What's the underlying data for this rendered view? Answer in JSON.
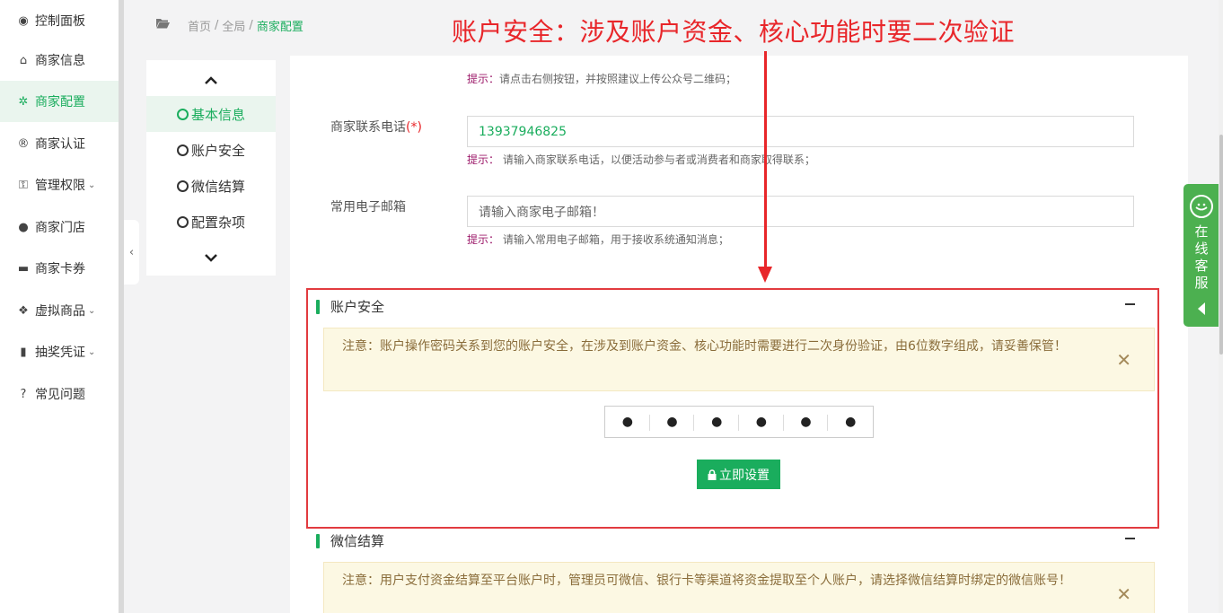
{
  "sidebar": {
    "items": [
      {
        "label": "控制面板",
        "icon": "dashboard-icon",
        "glyph": "◉",
        "caret": ""
      },
      {
        "label": "商家信息",
        "icon": "home-icon",
        "glyph": "⌂",
        "caret": ""
      },
      {
        "label": "商家配置",
        "icon": "gears-icon",
        "glyph": "✲",
        "caret": "",
        "active": true
      },
      {
        "label": "商家认证",
        "icon": "registered-icon",
        "glyph": "®",
        "caret": ""
      },
      {
        "label": "管理权限",
        "icon": "key-icon",
        "glyph": "⚿",
        "caret": "⌄"
      },
      {
        "label": "商家门店",
        "icon": "map-pin-icon",
        "glyph": "●",
        "caret": ""
      },
      {
        "label": "商家卡券",
        "icon": "credit-card-icon",
        "glyph": "▬",
        "caret": ""
      },
      {
        "label": "虚拟商品",
        "icon": "dropbox-icon",
        "glyph": "❖",
        "caret": "⌄"
      },
      {
        "label": "抽奖凭证",
        "icon": "bookmark-icon",
        "glyph": "▮",
        "caret": "⌄"
      },
      {
        "label": "常见问题",
        "icon": "question-circle-icon",
        "glyph": "?",
        "caret": ""
      }
    ]
  },
  "collapse_glyph": "‹",
  "breadcrumb": {
    "home": "首页",
    "sep1": "/",
    "global": "全局",
    "sep2": "/",
    "current": "商家配置"
  },
  "annotation": {
    "text": "账户安全：涉及账户资金、核心功能时要二次验证",
    "color": "#e8262a"
  },
  "subnav": {
    "up": "⌃",
    "down": "⌄",
    "items": [
      {
        "label": "基本信息",
        "active": true
      },
      {
        "label": "账户安全"
      },
      {
        "label": "微信结算"
      },
      {
        "label": "配置杂项"
      }
    ]
  },
  "form": {
    "qr_hint_label": "提示：",
    "qr_hint_text": "请点击右侧按钮，并按照建议上传公众号二维码；",
    "phone_label": "商家联系电话",
    "phone_required": "(*)",
    "phone_value": "13937946825",
    "phone_hint_label": "提示：",
    "phone_hint_text": "请输入商家联系电话，以便活动参与者或消费者和商家取得联系；",
    "email_label": "常用电子邮箱",
    "email_placeholder": "请输入商家电子邮箱！",
    "email_hint_label": "提示：",
    "email_hint_text": "请输入常用电子邮箱，用于接收系统通知消息；"
  },
  "account_security": {
    "title": "账户安全",
    "notice": "注意：账户操作密码关系到您的账户安全，在涉及到账户资金、核心功能时需要进行二次身份验证，由6位数字组成，请妥善保管！",
    "close": "✕",
    "pwd_dots": [
      "●",
      "●",
      "●",
      "●",
      "●",
      "●"
    ],
    "button_icon": "🔒",
    "button_label": "立即设置"
  },
  "wechat_settlement": {
    "title": "微信结算",
    "notice": "注意：用户支付资金结算至平台账户时，管理员可微信、银行卡等渠道将资金提取至个人账户，请选择微信结算时绑定的微信账号！",
    "close": "✕"
  },
  "customer_service": {
    "label": "在线客服"
  },
  "colors": {
    "accent": "#1aad5d",
    "annotation_red": "#e8262a",
    "notice_bg": "#fcf8e3",
    "hint_label": "#9c1a6a"
  }
}
